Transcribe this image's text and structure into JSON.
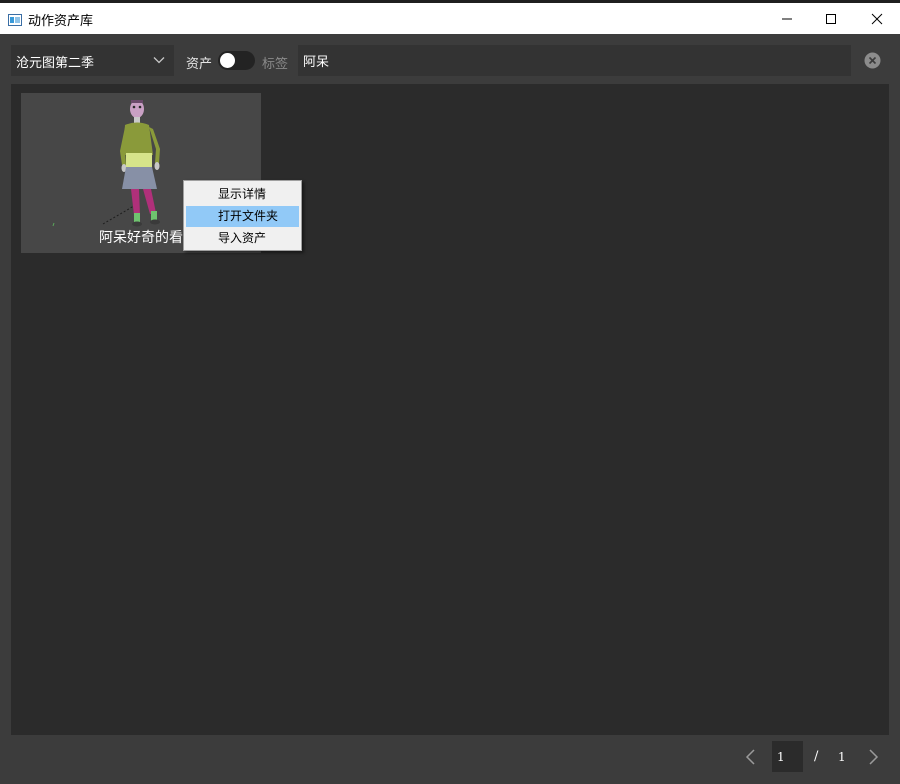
{
  "window": {
    "title": "动作资产库",
    "icon": "app-window-icon",
    "controls": [
      "minimize-icon",
      "maximize-icon",
      "close-icon"
    ]
  },
  "toolbar": {
    "project_select": {
      "value": "沧元图第二季",
      "icon": "chevron-down-icon"
    },
    "mode_toggle": {
      "left_label": "资产",
      "right_label": "标签",
      "state": "资产"
    },
    "search": {
      "value": "阿呆",
      "clear_icon": "clear-circle-icon"
    }
  },
  "assets": [
    {
      "caption": "阿呆好奇的看"
    }
  ],
  "context_menu": {
    "items": [
      {
        "label": "显示详情"
      },
      {
        "label": "打开文件夹"
      },
      {
        "label": "导入资产"
      }
    ],
    "highlighted": "打开文件夹"
  },
  "pagination": {
    "current": "1",
    "separator": "/",
    "total": "1",
    "prev_icon": "chevron-left-icon",
    "next_icon": "chevron-right-icon"
  },
  "colors": {
    "background": "#3c3c3c",
    "content": "#2b2b2b",
    "card": "#474747",
    "menu_highlight": "#91c9f7"
  }
}
